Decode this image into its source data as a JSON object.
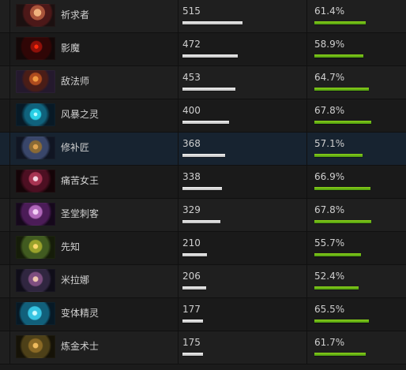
{
  "heroes": [
    {
      "name": "祈求者",
      "matches": "515",
      "matches_fraction": 0.5,
      "winrate": "61.4%",
      "winrate_fraction": 0.614
    },
    {
      "name": "影魔",
      "matches": "472",
      "matches_fraction": 0.458,
      "winrate": "58.9%",
      "winrate_fraction": 0.589
    },
    {
      "name": "敌法师",
      "matches": "453",
      "matches_fraction": 0.44,
      "winrate": "64.7%",
      "winrate_fraction": 0.647
    },
    {
      "name": "风暴之灵",
      "matches": "400",
      "matches_fraction": 0.388,
      "winrate": "67.8%",
      "winrate_fraction": 0.678
    },
    {
      "name": "修补匠",
      "matches": "368",
      "matches_fraction": 0.357,
      "winrate": "57.1%",
      "winrate_fraction": 0.571
    },
    {
      "name": "痛苦女王",
      "matches": "338",
      "matches_fraction": 0.328,
      "winrate": "66.9%",
      "winrate_fraction": 0.669
    },
    {
      "name": "圣堂刺客",
      "matches": "329",
      "matches_fraction": 0.319,
      "winrate": "67.8%",
      "winrate_fraction": 0.678
    },
    {
      "name": "先知",
      "matches": "210",
      "matches_fraction": 0.204,
      "winrate": "55.7%",
      "winrate_fraction": 0.557
    },
    {
      "name": "米拉娜",
      "matches": "206",
      "matches_fraction": 0.2,
      "winrate": "52.4%",
      "winrate_fraction": 0.524
    },
    {
      "name": "变体精灵",
      "matches": "177",
      "matches_fraction": 0.172,
      "winrate": "65.5%",
      "winrate_fraction": 0.655
    },
    {
      "name": "炼金术士",
      "matches": "175",
      "matches_fraction": 0.17,
      "winrate": "61.7%",
      "winrate_fraction": 0.617
    }
  ],
  "colors": {
    "background": "#1b1b1b",
    "highlight_row": "#172330",
    "matches_bar": "#d9d9d9",
    "winrate_bar": "#6cb417"
  },
  "icons": [
    "invoker-portrait",
    "shadow-fiend-portrait",
    "anti-mage-portrait",
    "storm-spirit-portrait",
    "tinker-portrait",
    "queen-of-pain-portrait",
    "templar-assassin-portrait",
    "natures-prophet-portrait",
    "mirana-portrait",
    "morphling-portrait",
    "alchemist-portrait"
  ]
}
